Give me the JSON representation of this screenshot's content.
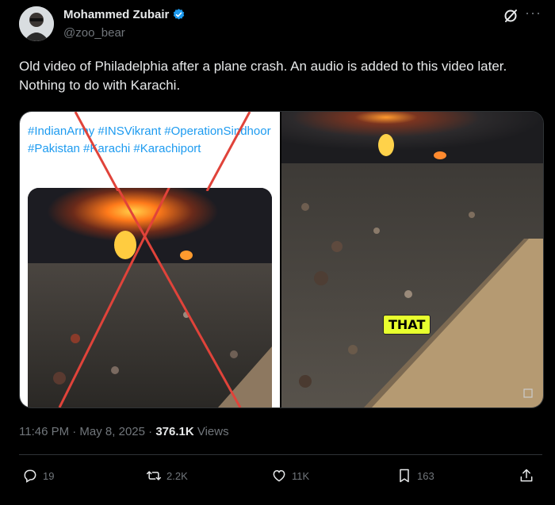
{
  "author": {
    "name": "Mohammed Zubair",
    "handle": "@zoo_bear"
  },
  "tweet_text": "Old video of Philadelphia after a plane crash. An audio is added to this video later. Nothing to do with Karachi.",
  "media": {
    "left_hashtags": "#IndianArmy #INSVikrant #OperationSindhoor #Pakistan #Karachi #Karachiport",
    "video_caption": "THAT"
  },
  "meta": {
    "time": "11:46 PM · May 8, 2025 · ",
    "views_count": "376.1K",
    "views_label": " Views"
  },
  "actions": {
    "replies": "19",
    "reposts": "2.2K",
    "likes": "11K",
    "bookmarks": "163"
  },
  "colors": {
    "background": "#000000",
    "text": "#e7e9ea",
    "muted": "#71767b",
    "link": "#1d9bf0",
    "verified": "#1d9bf0",
    "cross": "#e0433a"
  },
  "icons": [
    "grok-icon",
    "more-icon",
    "verified-icon",
    "reply-icon",
    "repost-icon",
    "like-icon",
    "bookmark-icon",
    "share-icon"
  ]
}
